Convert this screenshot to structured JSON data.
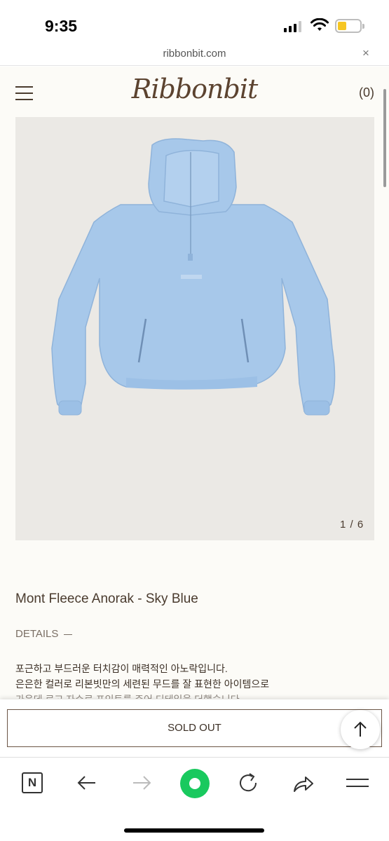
{
  "status_bar": {
    "time": "9:35",
    "signal_icon": "cellular-signal-icon",
    "wifi_icon": "wifi-icon",
    "battery_icon": "battery-low-icon",
    "battery_color": "#f6c623"
  },
  "browser": {
    "url": "ribbonbit.com",
    "close_label": "×"
  },
  "header": {
    "menu_icon": "hamburger-menu-icon",
    "logo": "Ribbonbit",
    "cart": "(0)"
  },
  "product": {
    "image_icon": "sky-blue-anorak-photo",
    "image_counter": "1 / 6",
    "title": "Mont Fleece Anorak - Sky Blue",
    "details_label": "DETAILS",
    "description": [
      "포근하고 부드러운 터치감이 매력적인 아노락입니다.",
      "은은한 컬러로 리본빗만의 세련된 무드를 잘 표현한 아이템으로",
      "가운데 로고 자수로 포인트를 주어 디테일을 더했습니다."
    ],
    "colors": {
      "garment": "#a7c8ea",
      "background": "#ebe9e5",
      "text": "#4a3b2e"
    }
  },
  "cta": {
    "sold_out_label": "SOLD OUT",
    "to_top_icon": "arrow-up-icon"
  },
  "toolbar": {
    "naver_label": "N",
    "back_icon": "arrow-left-icon",
    "forward_icon": "arrow-right-icon",
    "green_icon": "naver-green-dot-icon",
    "green_color": "#19c95e",
    "reload_icon": "reload-icon",
    "share_icon": "share-icon",
    "menu_icon": "menu-lines-icon"
  }
}
